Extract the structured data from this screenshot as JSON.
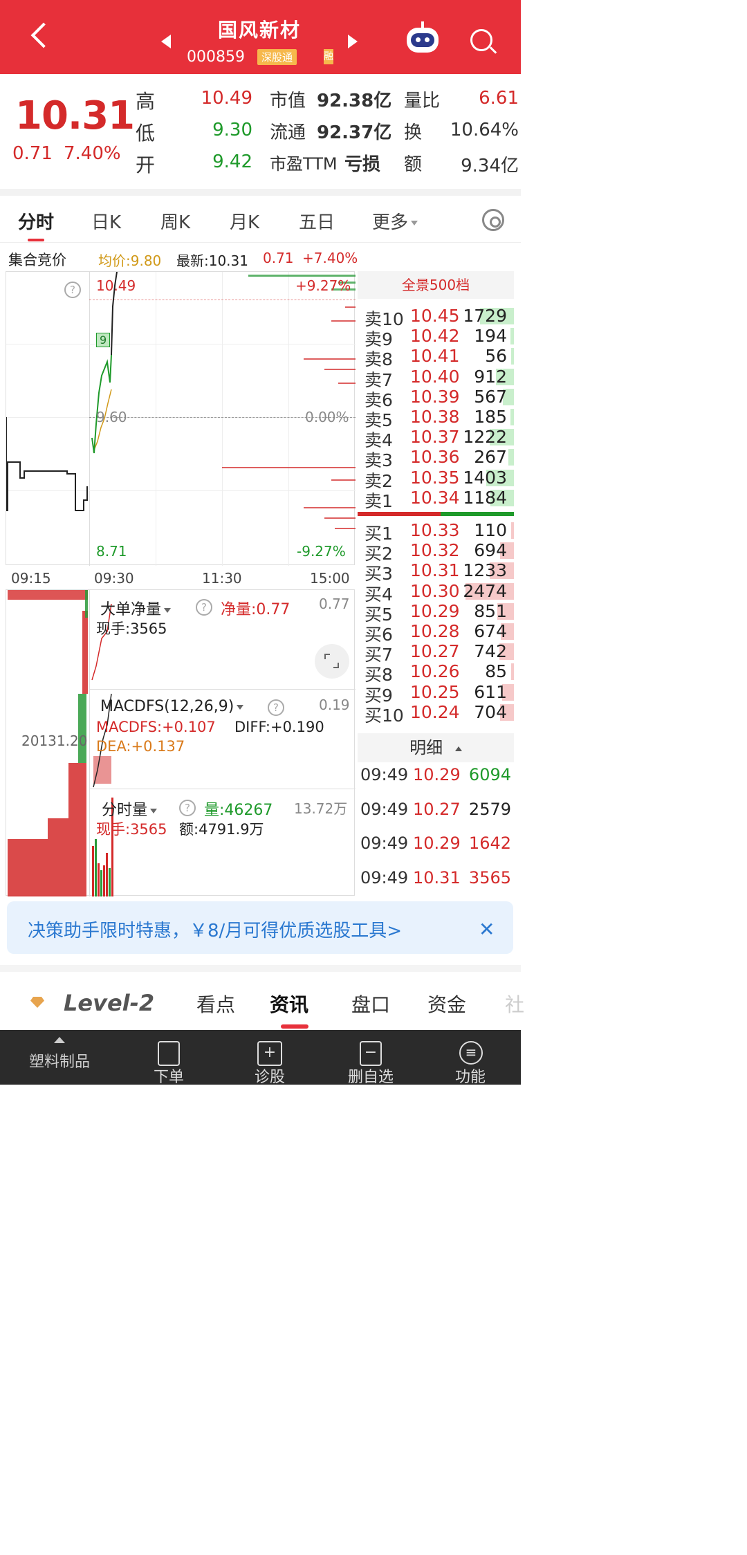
{
  "header": {
    "stock_name": "国风新材",
    "stock_code": "000859",
    "badge": "深股通",
    "extra_badge": "融"
  },
  "quote": {
    "price": "10.31",
    "change": "0.71",
    "change_pct": "7.40%",
    "high_label": "高",
    "high": "10.49",
    "low_label": "低",
    "low": "9.30",
    "open_label": "开",
    "open": "9.42",
    "mktcap_label": "市值",
    "mktcap": "92.38亿",
    "float_label": "流通",
    "float": "92.37亿",
    "pe_label": "市盈TTM",
    "pe": "亏损",
    "volratio_label": "量比",
    "volratio": "6.61",
    "turnover_label": "换",
    "turnover": "10.64%",
    "amount_label": "额",
    "amount": "9.34亿"
  },
  "period_tabs": [
    "分时",
    "日K",
    "周K",
    "月K",
    "五日",
    "更多"
  ],
  "info_row": {
    "auction": "集合竞价",
    "avg": "均价:9.80",
    "latest": "最新:10.31",
    "chg": "0.71",
    "chg_pct": "+7.40%"
  },
  "chart": {
    "top_price": "10.49",
    "top_pct": "+9.27%",
    "mid_price": "9.60",
    "mid_pct": "0.00%",
    "bottom_price": "8.71",
    "bottom_pct": "-9.27%",
    "marker": "9",
    "times": [
      "09:15",
      "09:30",
      "11:30",
      "15:00"
    ]
  },
  "panes": {
    "big_order_title": "大单净量",
    "big_order_net": "净量:0.77",
    "big_order_right": "0.77",
    "big_order_hand": "现手:3565",
    "macd_title": "MACDFS(12,26,9)",
    "macd_right": "0.19",
    "macd_val": "MACDFS:+0.107",
    "diff_val": "DIFF:+0.190",
    "dea_val": "DEA:+0.137",
    "auction_vol": "20131.20",
    "vol_title": "分时量",
    "vol_val": "量:46267",
    "vol_right": "13.72万",
    "vol_hand": "现手:3565",
    "vol_amount": "额:4791.9万"
  },
  "orderbook": {
    "title": "全景500档",
    "sells": [
      {
        "label": "卖10",
        "price": "10.45",
        "vol": "1729"
      },
      {
        "label": "卖9",
        "price": "10.42",
        "vol": "194"
      },
      {
        "label": "卖8",
        "price": "10.41",
        "vol": "56"
      },
      {
        "label": "卖7",
        "price": "10.40",
        "vol": "912"
      },
      {
        "label": "卖6",
        "price": "10.39",
        "vol": "567"
      },
      {
        "label": "卖5",
        "price": "10.38",
        "vol": "185"
      },
      {
        "label": "卖4",
        "price": "10.37",
        "vol": "1222"
      },
      {
        "label": "卖3",
        "price": "10.36",
        "vol": "267"
      },
      {
        "label": "卖2",
        "price": "10.35",
        "vol": "1403"
      },
      {
        "label": "卖1",
        "price": "10.34",
        "vol": "1184"
      }
    ],
    "buys": [
      {
        "label": "买1",
        "price": "10.33",
        "vol": "110"
      },
      {
        "label": "买2",
        "price": "10.32",
        "vol": "694"
      },
      {
        "label": "买3",
        "price": "10.31",
        "vol": "1233"
      },
      {
        "label": "买4",
        "price": "10.30",
        "vol": "2474"
      },
      {
        "label": "买5",
        "price": "10.29",
        "vol": "851"
      },
      {
        "label": "买6",
        "price": "10.28",
        "vol": "674"
      },
      {
        "label": "买7",
        "price": "10.27",
        "vol": "742"
      },
      {
        "label": "买8",
        "price": "10.26",
        "vol": "85"
      },
      {
        "label": "买9",
        "price": "10.25",
        "vol": "611"
      },
      {
        "label": "买10",
        "price": "10.24",
        "vol": "704"
      }
    ]
  },
  "detail": {
    "title": "明细",
    "rows": [
      {
        "time": "09:49",
        "price": "10.29",
        "vol": "6094",
        "color": "#1f9a2b"
      },
      {
        "time": "09:49",
        "price": "10.27",
        "vol": "2579",
        "color": "#222222"
      },
      {
        "time": "09:49",
        "price": "10.29",
        "vol": "1642",
        "color": "#d42a2a"
      },
      {
        "time": "09:49",
        "price": "10.31",
        "vol": "3565",
        "color": "#d42a2a"
      }
    ]
  },
  "promo": {
    "text": "决策助手限时特惠，￥8/月可得优质选股工具>",
    "close": "✕"
  },
  "bottom_tabs": {
    "level2": "Level-2",
    "items": [
      "看点",
      "资讯",
      "盘口",
      "资金",
      "社"
    ]
  },
  "bottom_nav": {
    "sector": "塑料制品",
    "items": [
      "下单",
      "诊股",
      "删自选",
      "功能"
    ]
  },
  "colors": {
    "brand_red": "#e7303a",
    "up": "#d42a2a",
    "down": "#1f9a2b"
  }
}
